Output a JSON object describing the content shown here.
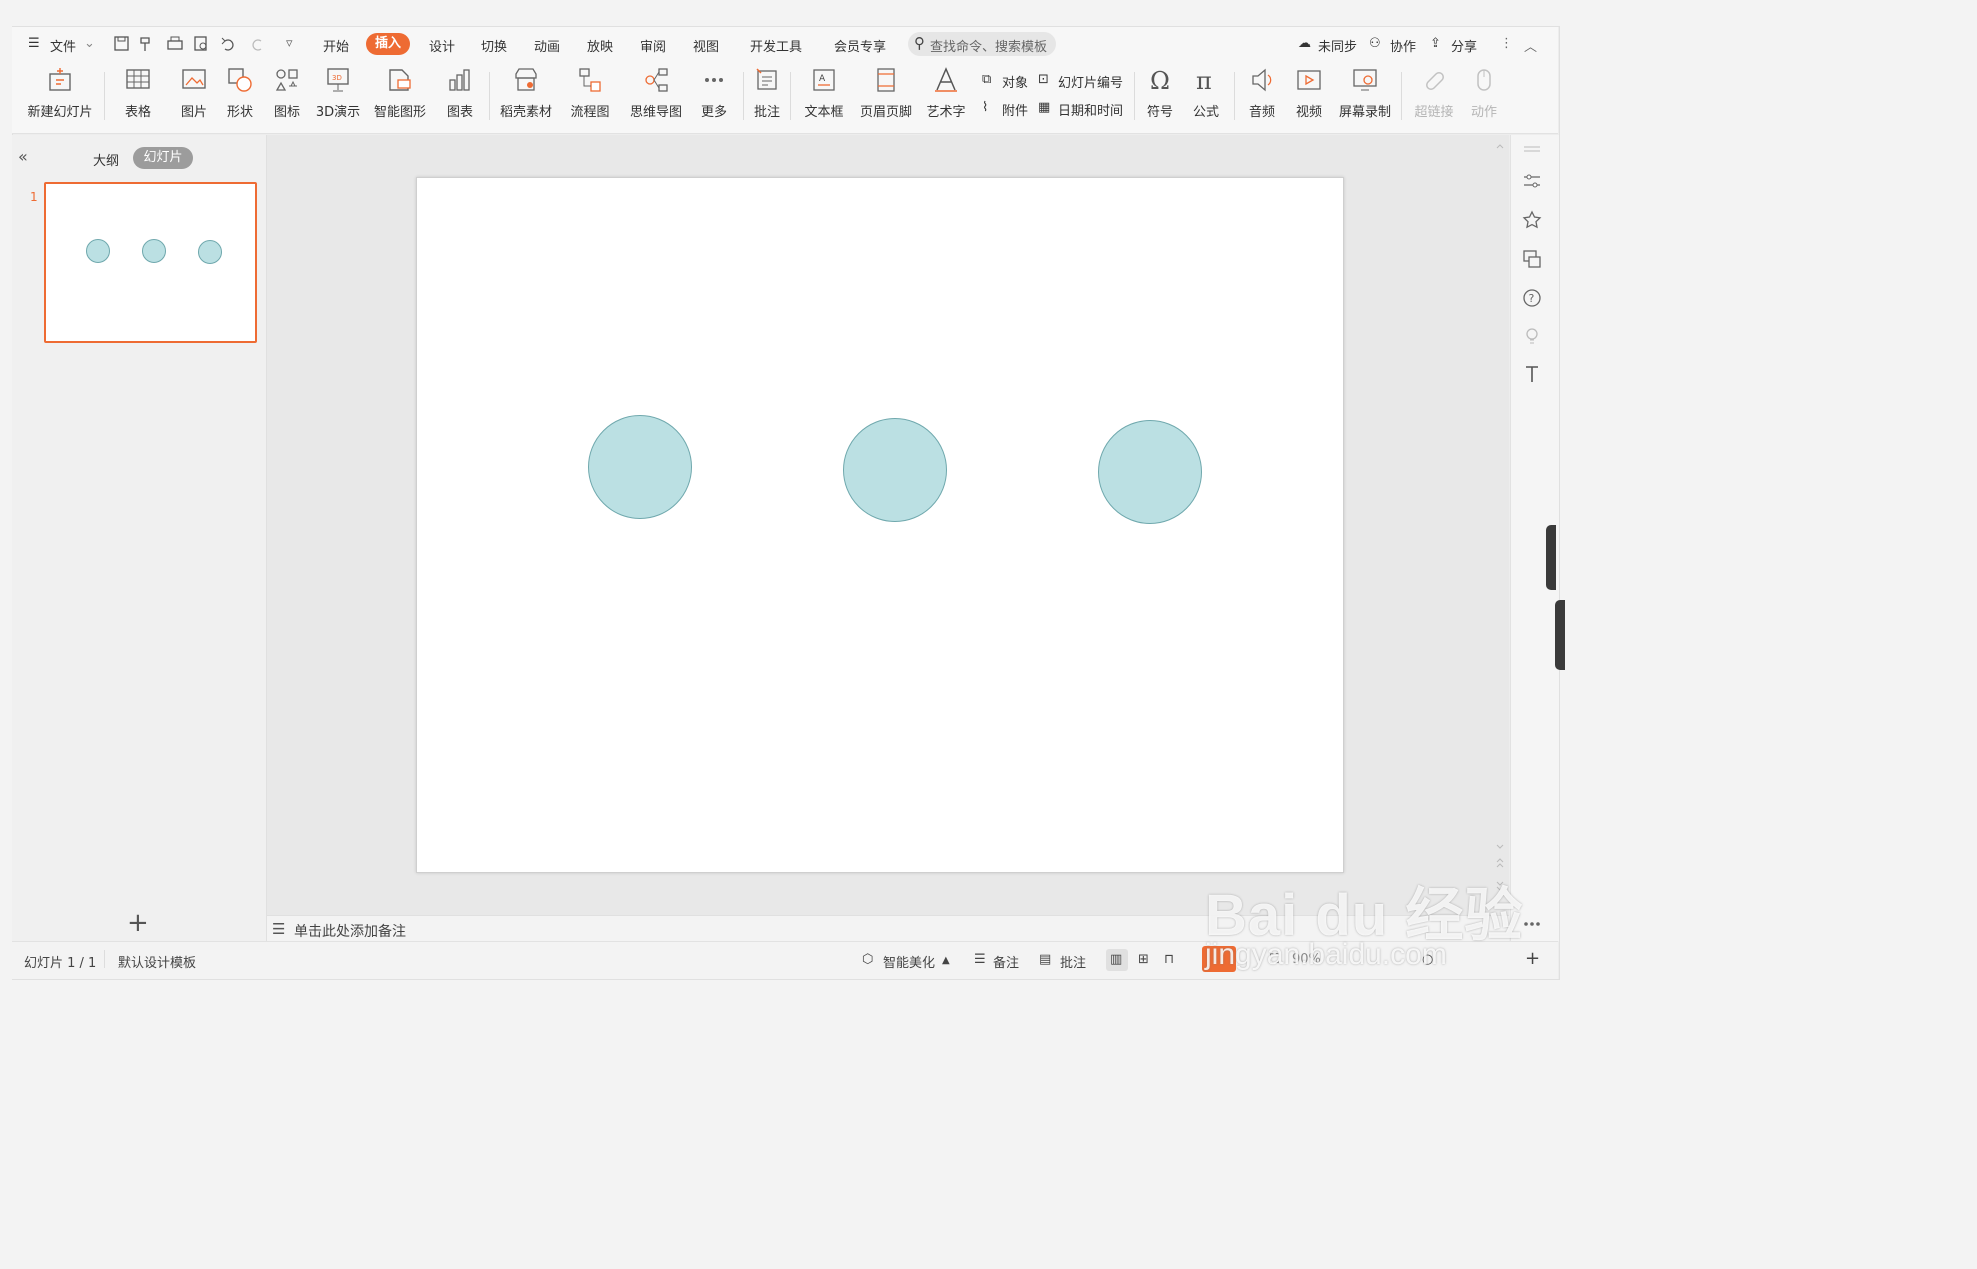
{
  "menu": {
    "file": "文件",
    "tabs": [
      "开始",
      "插入",
      "设计",
      "切换",
      "动画",
      "放映",
      "审阅",
      "视图",
      "开发工具",
      "会员专享"
    ],
    "search_placeholder": "查找命令、搜索模板",
    "right": {
      "sync": "未同步",
      "collab": "协作",
      "share": "分享"
    }
  },
  "ribbon": {
    "new_slide": "新建幻灯片",
    "table": "表格",
    "picture": "图片",
    "shape": "形状",
    "icon": "图标",
    "demo3d": "3D演示",
    "smart": "智能图形",
    "chart": "图表",
    "material": "稻壳素材",
    "flow": "流程图",
    "mindmap": "思维导图",
    "more": "更多",
    "comment": "批注",
    "textbox": "文本框",
    "header_footer": "页眉页脚",
    "wordart": "艺术字",
    "object": "对象",
    "slide_number": "幻灯片编号",
    "attachment": "附件",
    "datetime": "日期和时间",
    "symbol": "符号",
    "formula": "公式",
    "audio": "音频",
    "video": "视频",
    "screen_record": "屏幕录制",
    "hyperlink": "超链接",
    "action": "动作"
  },
  "panel": {
    "outline": "大纲",
    "slides": "幻灯片",
    "slide_number": "1",
    "add": "+"
  },
  "notes": {
    "placeholder": "单击此处添加备注"
  },
  "status": {
    "slide_pos": "幻灯片 1 / 1",
    "template": "默认设计模板",
    "beautify": "智能美化",
    "notes": "备注",
    "comments": "批注",
    "zoom": "90%"
  },
  "watermark": {
    "logo": "Bai du 经验",
    "url": "jingyan.baidu.com"
  },
  "colors": {
    "accent": "#ee6b33",
    "circle_fill": "#bbe0e3",
    "circle_stroke": "#6fa8ad"
  }
}
